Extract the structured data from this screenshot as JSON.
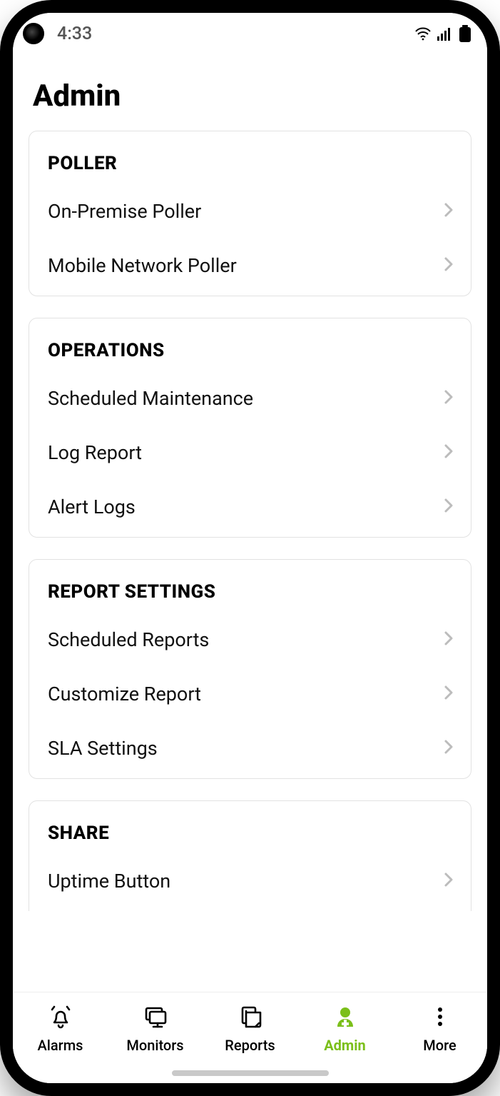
{
  "status": {
    "time": "4:33"
  },
  "header": {
    "title": "Admin"
  },
  "sections": [
    {
      "id": "poller",
      "title": "POLLER",
      "items": [
        {
          "id": "on-premise-poller",
          "label": "On-Premise Poller"
        },
        {
          "id": "mobile-network-poller",
          "label": "Mobile Network Poller"
        }
      ]
    },
    {
      "id": "operations",
      "title": "OPERATIONS",
      "items": [
        {
          "id": "scheduled-maintenance",
          "label": "Scheduled Maintenance"
        },
        {
          "id": "log-report",
          "label": "Log Report"
        },
        {
          "id": "alert-logs",
          "label": "Alert Logs"
        }
      ]
    },
    {
      "id": "report-settings",
      "title": "REPORT SETTINGS",
      "items": [
        {
          "id": "scheduled-reports",
          "label": "Scheduled Reports"
        },
        {
          "id": "customize-report",
          "label": "Customize Report"
        },
        {
          "id": "sla-settings",
          "label": "SLA Settings"
        }
      ]
    },
    {
      "id": "share",
      "title": "SHARE",
      "items": [
        {
          "id": "uptime-button",
          "label": "Uptime Button"
        }
      ]
    }
  ],
  "tabs": [
    {
      "id": "alarms",
      "label": "Alarms",
      "active": false
    },
    {
      "id": "monitors",
      "label": "Monitors",
      "active": false
    },
    {
      "id": "reports",
      "label": "Reports",
      "active": false
    },
    {
      "id": "admin",
      "label": "Admin",
      "active": true
    },
    {
      "id": "more",
      "label": "More",
      "active": false
    }
  ],
  "colors": {
    "accent": "#7bbf1a",
    "border": "#e2e2e2",
    "chevron": "#bcbcbc"
  }
}
